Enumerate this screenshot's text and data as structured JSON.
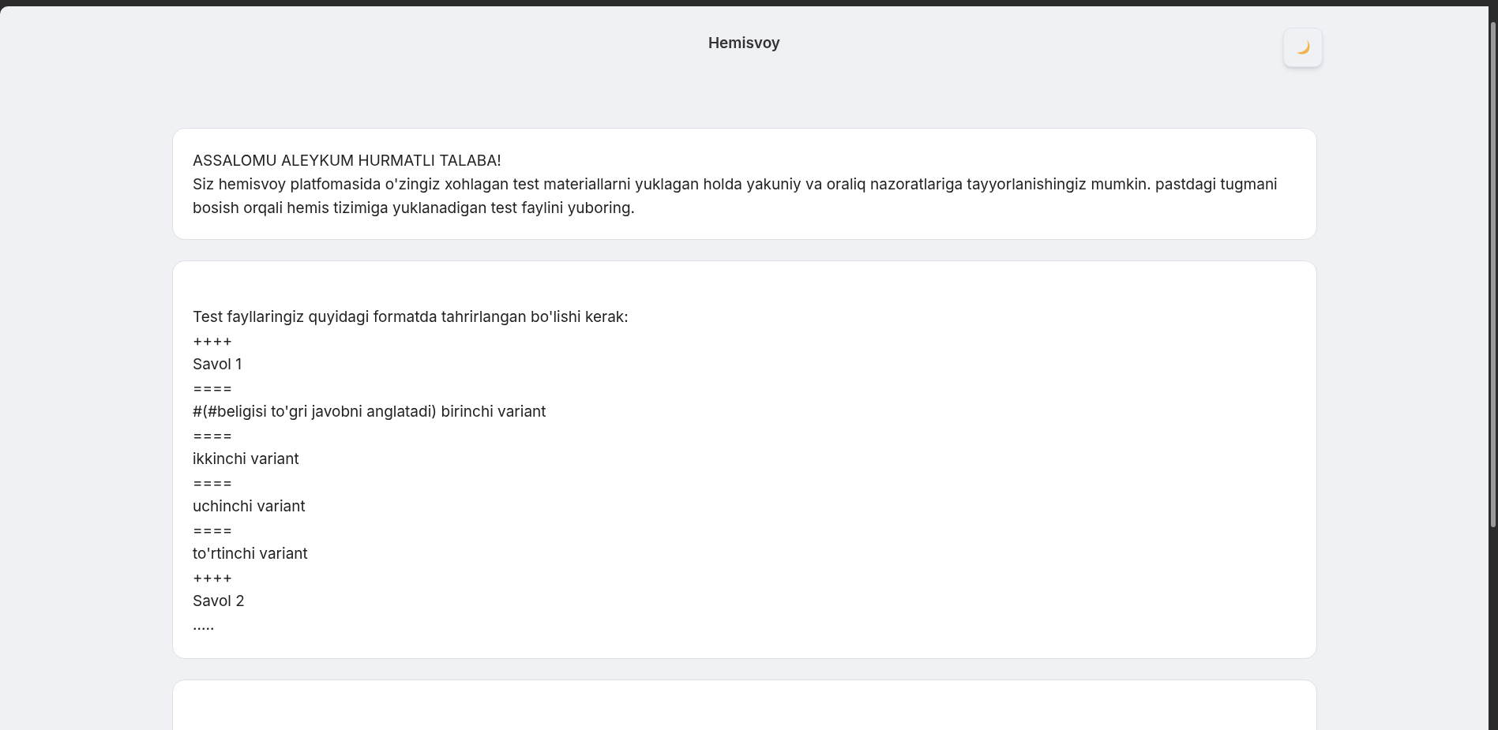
{
  "header": {
    "title": "Hemisvoy",
    "theme_toggle": {
      "dark": false
    }
  },
  "welcome_card": {
    "heading": "ASSALOMU ALEYKUM HURMATLI TALABA!",
    "text": "Siz hemisvoy platfomasida o'zingiz xohlagan test materiallarni yuklagan holda yakuniy va oraliq nazoratlariga tayyorlanishingiz mumkin. pastdagi tugmani bosish orqali hemis tizimiga yuklanadigan test faylini yuboring."
  },
  "format_card": {
    "lines": [
      "Test fayllaringiz quyidagi formatda tahrirlangan bo'lishi kerak:",
      "++++",
      "Savol 1",
      "====",
      "#(#beligisi to'gri javobni anglatadi) birinchi variant",
      "====",
      "ikkinchi variant",
      "====",
      "uchinchi variant",
      "====",
      "to'rtinchi variant",
      "++++",
      "Savol 2",
      "....."
    ]
  }
}
